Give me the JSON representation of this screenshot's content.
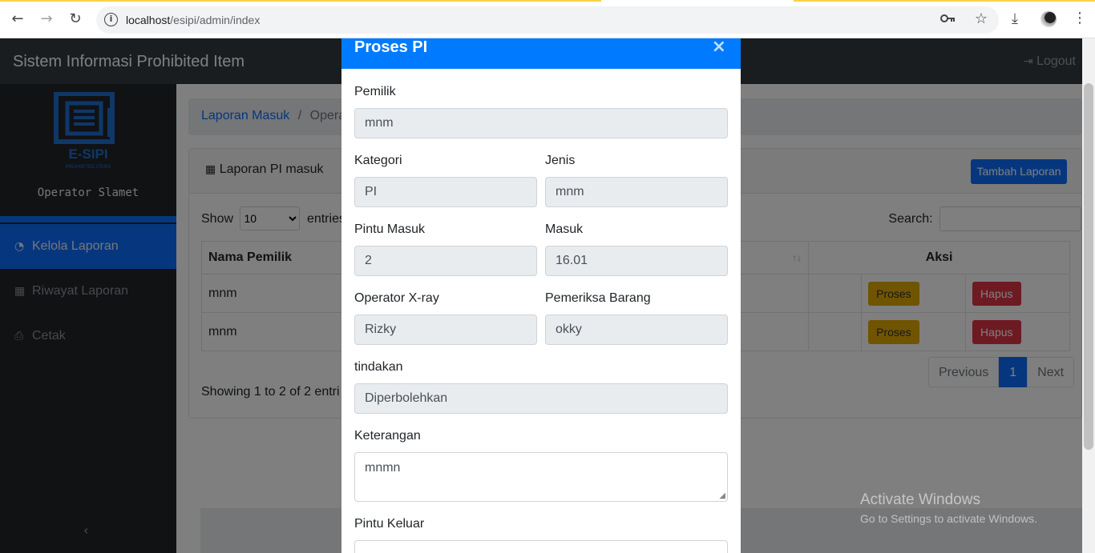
{
  "browser": {
    "url_host": "localhost",
    "url_path": "/esipi/admin/index"
  },
  "app": {
    "brand": "Sistem Informasi Prohibited Item",
    "logout_label": "Logout"
  },
  "sidebar": {
    "logo_text": "E-SIPI",
    "logo_subtext": "PROHIBITED ITEMS",
    "operator_name": "Operator Slamet",
    "items": [
      {
        "label": "Kelola Laporan",
        "icon": "dashboard-icon",
        "active": true
      },
      {
        "label": "Riwayat Laporan",
        "icon": "table-icon",
        "active": false
      },
      {
        "label": "Cetak",
        "icon": "print-icon",
        "active": false
      }
    ]
  },
  "breadcrumb": {
    "link": "Laporan Masuk",
    "separator": "/",
    "current": "Opera"
  },
  "card": {
    "title": "Laporan PI masuk",
    "add_button": "Tambah Laporan",
    "show_label": "Show",
    "show_value": "10",
    "entries_label": "entries",
    "search_label": "Search:",
    "columns": [
      "Nama Pemilik",
      "Aksi"
    ],
    "rows": [
      {
        "nama": "mnm",
        "proses": "Proses",
        "hapus": "Hapus"
      },
      {
        "nama": "mnm",
        "proses": "Proses",
        "hapus": "Hapus"
      }
    ],
    "showing": "Showing 1 to 2 of 2 entri",
    "pager": {
      "prev": "Previous",
      "page": "1",
      "next": "Next"
    }
  },
  "modal": {
    "title": "Proses PI",
    "close": "×",
    "pemilik_label": "Pemilik",
    "pemilik_value": "mnm",
    "kategori_label": "Kategori",
    "kategori_value": "PI",
    "jenis_label": "Jenis",
    "jenis_value": "mnm",
    "pintu_masuk_label": "Pintu Masuk",
    "pintu_masuk_value": "2",
    "masuk_label": "Masuk",
    "masuk_value": "16.01",
    "operator_label": "Operator X-ray",
    "operator_value": "Rizky",
    "pemeriksa_label": "Pemeriksa Barang",
    "pemeriksa_value": "okky",
    "tindakan_label": "tindakan",
    "tindakan_value": "Diperbolehkan",
    "keterangan_label": "Keterangan",
    "keterangan_value": "mnmn",
    "pintu_keluar_label": "Pintu Keluar"
  },
  "watermark": {
    "line1": "Activate Windows",
    "line2": "Go to Settings to activate Windows."
  }
}
